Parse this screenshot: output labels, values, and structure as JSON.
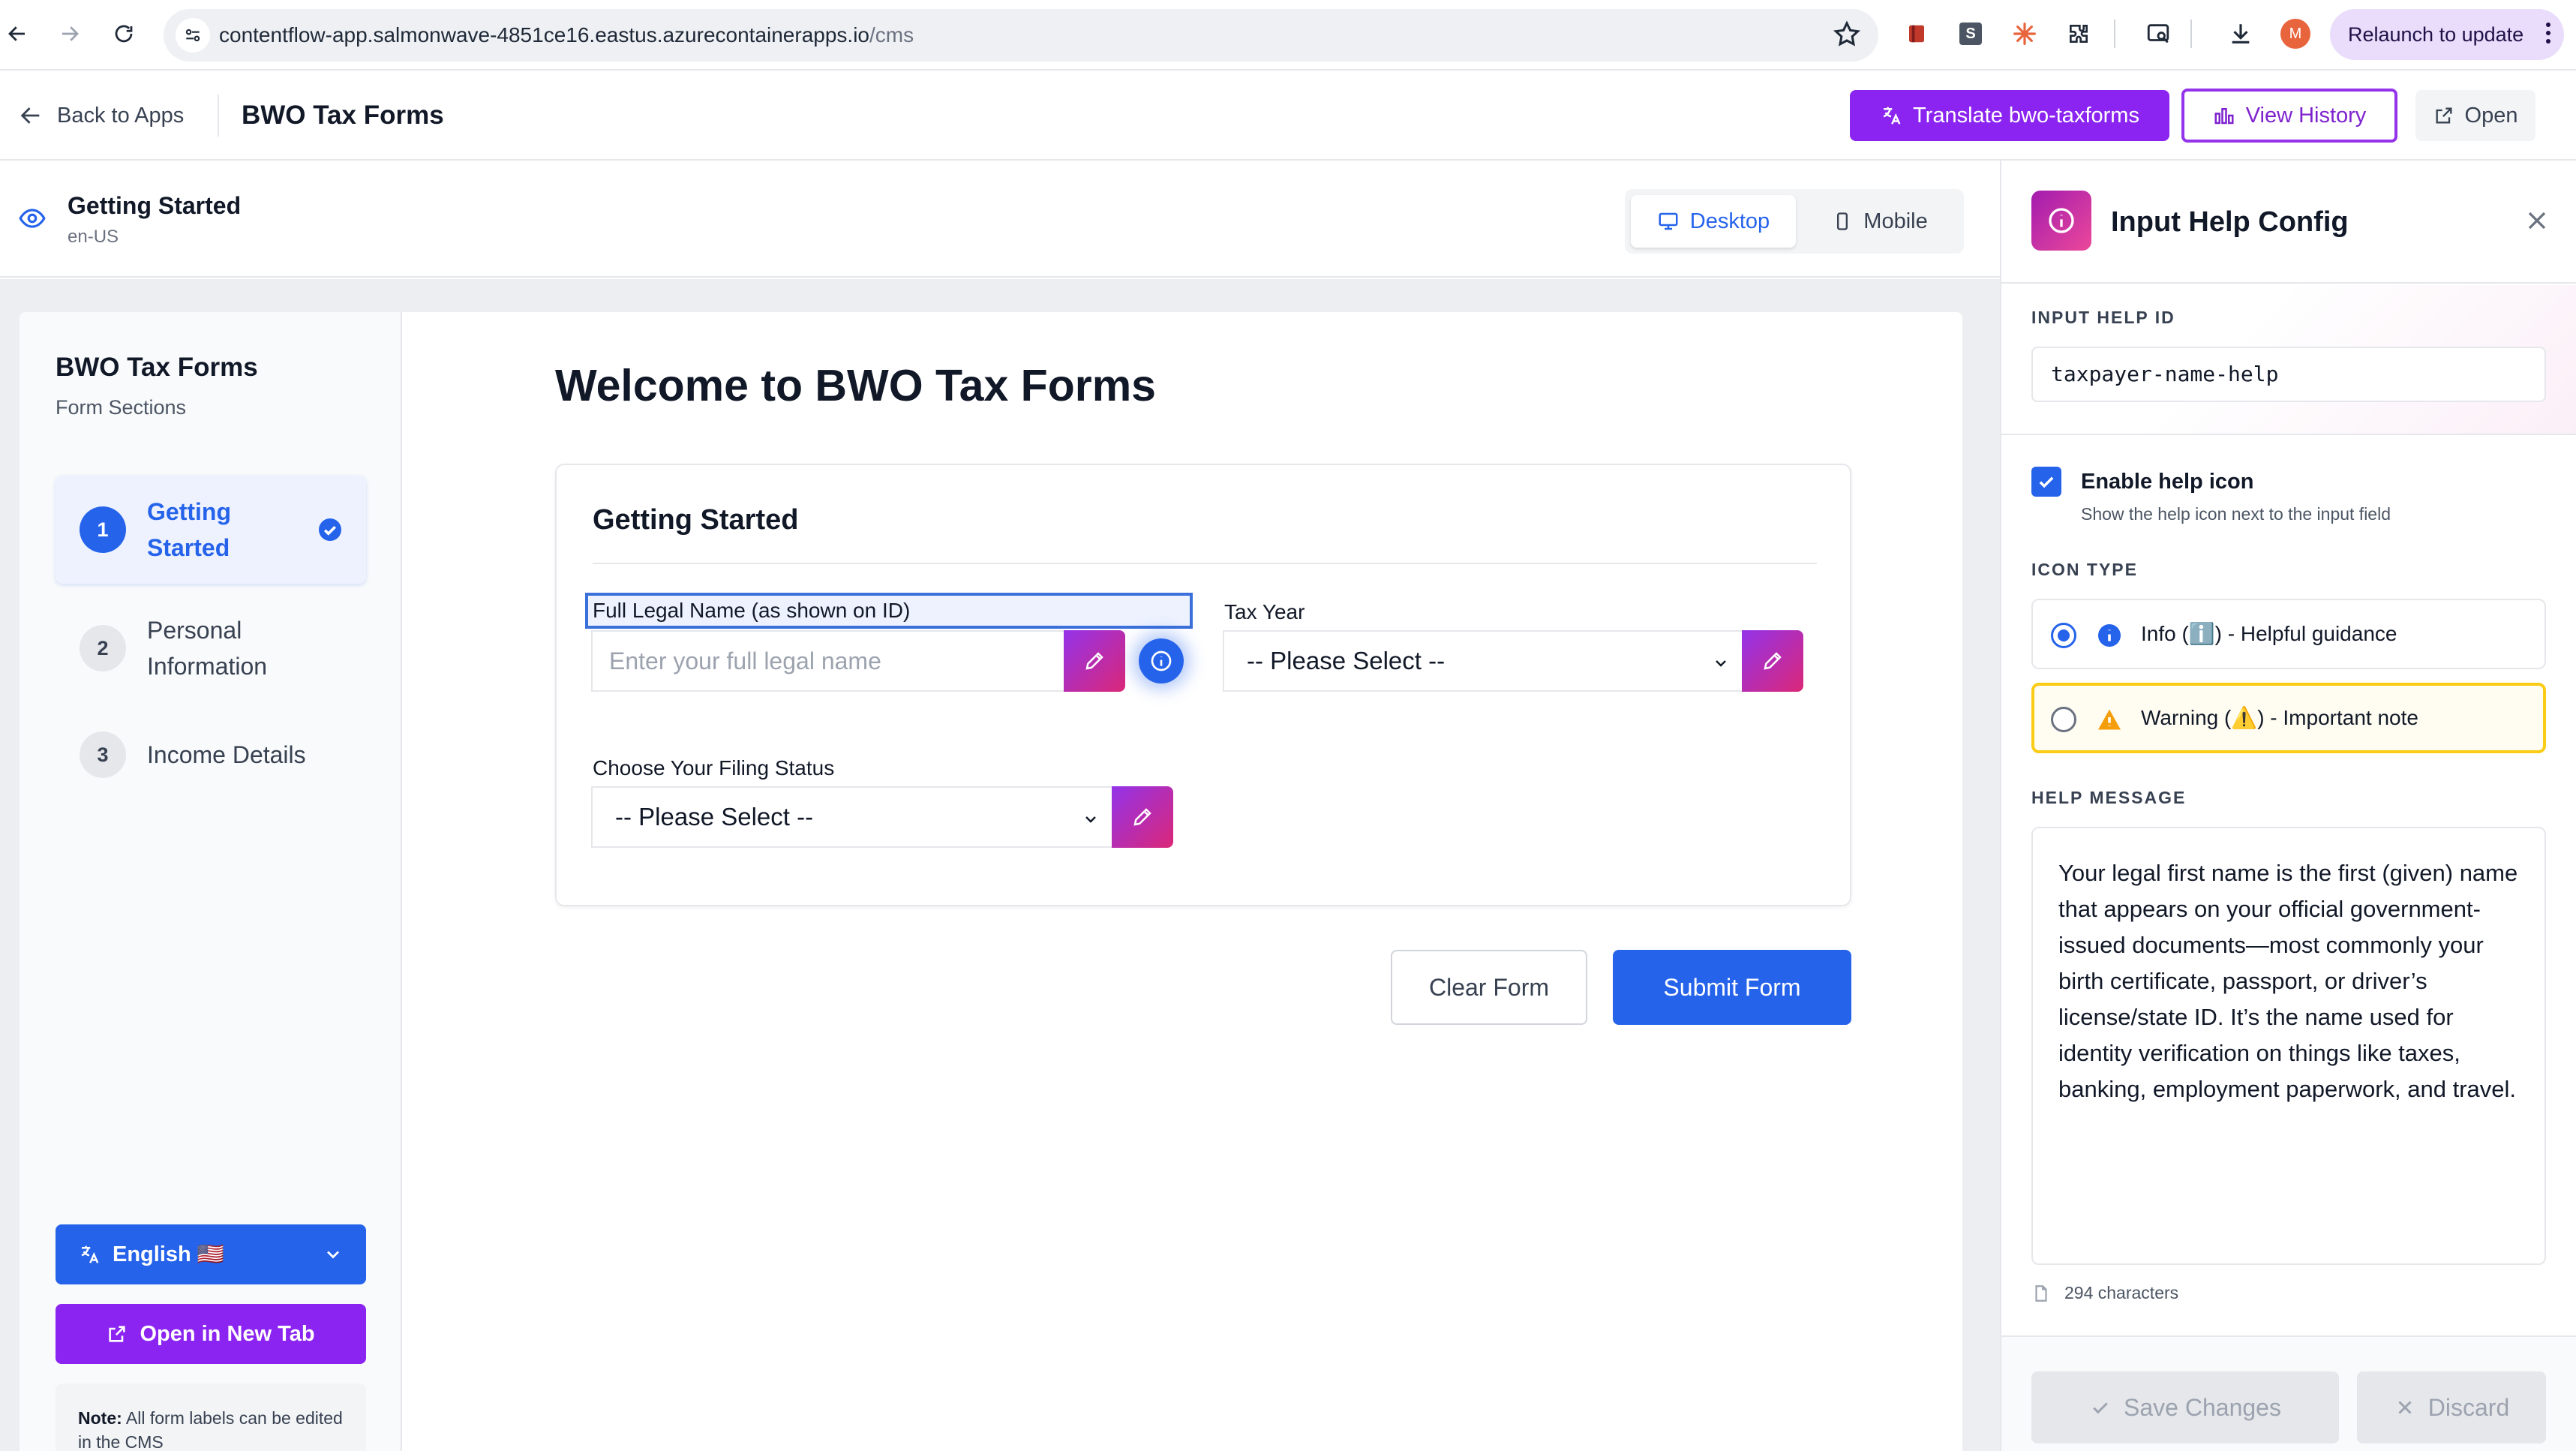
{
  "browser": {
    "url_main": "contentflow-app.salmonwave-4851ce16.eastus.azurecontainerapps.io",
    "url_path": "/cms",
    "profile_initial": "M",
    "relaunch_label": "Relaunch to update",
    "ext_s_label": "S"
  },
  "header": {
    "back_label": "Back to Apps",
    "app_title": "BWO Tax Forms",
    "translate_label": "Translate bwo-taxforms",
    "history_label": "View History",
    "open_label": "Open"
  },
  "preview": {
    "page_title": "Getting Started",
    "locale": "en-US",
    "desktop_label": "Desktop",
    "mobile_label": "Mobile"
  },
  "form_sidebar": {
    "title": "BWO Tax Forms",
    "subtitle": "Form Sections",
    "steps": [
      {
        "num": "1",
        "label": "Getting Started"
      },
      {
        "num": "2",
        "label": "Personal Information"
      },
      {
        "num": "3",
        "label": "Income Details"
      }
    ],
    "language_label": "English 🇺🇸",
    "open_new_tab_label": "Open in New Tab",
    "note_bold": "Note:",
    "note_text": " All form labels can be edited in the CMS"
  },
  "form": {
    "welcome": "Welcome to BWO Tax Forms",
    "section_title": "Getting Started",
    "full_name_label": "Full Legal Name (as shown on ID)",
    "full_name_placeholder": "Enter your full legal name",
    "tax_year_label": "Tax Year",
    "tax_year_value": "-- Please Select --",
    "filing_status_label": "Choose Your Filing Status",
    "filing_status_value": "-- Please Select --",
    "clear_label": "Clear Form",
    "submit_label": "Submit Form"
  },
  "config": {
    "title": "Input Help Config",
    "id_label": "INPUT HELP ID",
    "id_value": "taxpayer-name-help",
    "enable_label": "Enable help icon",
    "enable_help": "Show the help icon next to the input field",
    "enable_checked": true,
    "icon_type_label": "ICON TYPE",
    "icon_info_label": "Info (ℹ️) - Helpful guidance",
    "icon_warning_label": "Warning (⚠️) - Important note",
    "selected_icon": "info",
    "message_label": "HELP MESSAGE",
    "message": "Your legal first name is the first (given) name that appears on your official government-issued documents—most commonly your birth certificate, passport, or driver’s license/state ID. It’s the name used for identity verification on things like taxes, banking, employment paperwork, and travel.",
    "char_count": "294 characters",
    "save_label": "Save Changes",
    "discard_label": "Discard"
  },
  "colors": {
    "primary_blue": "#2563eb",
    "accent_purple": "#8b24f0",
    "edit_gradient_start": "#9333ea",
    "edit_gradient_end": "#db2777",
    "warning_border": "#facc15"
  },
  "icons": [
    "back-arrow-icon",
    "forward-arrow-icon",
    "reload-icon",
    "site-settings-icon",
    "star-icon",
    "extensions-icon",
    "download-icon",
    "translate-icon",
    "history-icon",
    "external-link-icon",
    "eye-icon",
    "monitor-icon",
    "phone-icon",
    "check-circle-icon",
    "chevron-down-icon",
    "pencil-icon",
    "info-icon",
    "warning-icon",
    "close-icon",
    "document-icon",
    "check-icon"
  ]
}
